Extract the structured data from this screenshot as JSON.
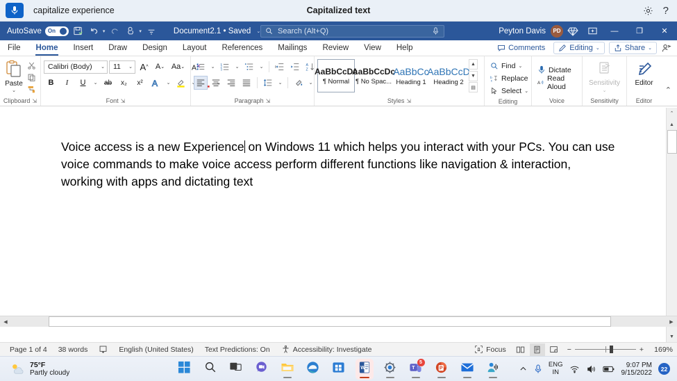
{
  "voice_access": {
    "mic_icon": "microphone-icon",
    "phrase": "capitalize experience",
    "title": "Capitalized text",
    "settings_icon": "gear-icon",
    "help_icon": "question-mark-icon"
  },
  "titlebar": {
    "autosave_label": "AutoSave",
    "autosave_state": "On",
    "save_icon": "save-icon",
    "undo_icon": "undo-icon",
    "redo_icon": "redo-icon",
    "touch_icon": "touch-mode-icon",
    "customize_icon": "customize-quick-access-icon",
    "document_name": "Document2.1 • Saved",
    "search_placeholder": "Search (Alt+Q)",
    "search_value": "",
    "search_icon": "search-icon",
    "search_mic_icon": "microphone-icon",
    "user_name": "Peyton Davis",
    "user_initials": "PD",
    "premium_icon": "diamond-icon",
    "ribbon_display_icon": "ribbon-display-options-icon",
    "minimize": "—",
    "restore": "❐",
    "close": "✕"
  },
  "tabs": [
    {
      "label": "File",
      "active": false
    },
    {
      "label": "Home",
      "active": true
    },
    {
      "label": "Insert",
      "active": false
    },
    {
      "label": "Draw",
      "active": false
    },
    {
      "label": "Design",
      "active": false
    },
    {
      "label": "Layout",
      "active": false
    },
    {
      "label": "References",
      "active": false
    },
    {
      "label": "Mailings",
      "active": false
    },
    {
      "label": "Review",
      "active": false
    },
    {
      "label": "View",
      "active": false
    },
    {
      "label": "Help",
      "active": false
    }
  ],
  "tabs_right": {
    "comments": "Comments",
    "editing": "Editing",
    "share": "Share",
    "catch_up_icon": "catch-up-person-icon"
  },
  "ribbon": {
    "clipboard": {
      "group_label": "Clipboard",
      "paste_label": "Paste",
      "cut_icon": "scissors-icon",
      "copy_icon": "copy-icon",
      "format_painter_icon": "format-painter-icon"
    },
    "font": {
      "group_label": "Font",
      "font_name": "Calibri (Body)",
      "font_size": "11",
      "grow_font": "A",
      "shrink_font": "A",
      "change_case": "Aa",
      "clear_formatting_icon": "clear-formatting-icon",
      "bold": "B",
      "italic": "I",
      "underline": "U",
      "strikethrough": "ab",
      "subscript": "x₂",
      "superscript": "x²",
      "text_effects_icon": "text-effects-icon",
      "highlight_icon": "highlight-icon",
      "font_color_icon": "font-color-icon"
    },
    "paragraph": {
      "group_label": "Paragraph",
      "bullets_icon": "bullets-icon",
      "numbering_icon": "numbering-icon",
      "multilevel_icon": "multilevel-list-icon",
      "decrease_indent_icon": "decrease-indent-icon",
      "increase_indent_icon": "increase-indent-icon",
      "sort_icon": "sort-icon",
      "show_marks_icon": "show-paragraph-marks-icon",
      "align_left_icon": "align-left-icon",
      "align_center_icon": "align-center-icon",
      "align_right_icon": "align-right-icon",
      "justify_icon": "justify-icon",
      "line_spacing_icon": "line-spacing-icon",
      "shading_icon": "shading-icon",
      "borders_icon": "borders-icon"
    },
    "styles": {
      "group_label": "Styles",
      "items": [
        {
          "preview": "AaBbCcDc",
          "name": "¶ Normal",
          "selected": true,
          "heading": false
        },
        {
          "preview": "AaBbCcDc",
          "name": "¶ No Spac...",
          "selected": false,
          "heading": false
        },
        {
          "preview": "AaBbCc",
          "name": "Heading 1",
          "selected": false,
          "heading": true
        },
        {
          "preview": "AaBbCcD",
          "name": "Heading 2",
          "selected": false,
          "heading": true
        }
      ]
    },
    "editing": {
      "group_label": "Editing",
      "find": "Find",
      "replace": "Replace",
      "select": "Select",
      "find_icon": "find-icon",
      "replace_icon": "replace-icon",
      "select_icon": "select-cursor-icon"
    },
    "voice": {
      "group_label": "Voice",
      "dictate": "Dictate",
      "read_aloud": "Read Aloud",
      "dictate_icon": "microphone-icon",
      "read_aloud_icon": "read-aloud-icon"
    },
    "sensitivity": {
      "group_label": "Sensitivity",
      "label": "Sensitivity",
      "icon": "sensitivity-label-icon"
    },
    "editor_group": {
      "group_label": "Editor",
      "label": "Editor",
      "icon": "editor-pen-icon",
      "collapse_icon": "collapse-ribbon-icon"
    }
  },
  "document": {
    "text_before_caret": "Voice access is a new Experience",
    "text_after_caret": " on Windows 11 which helps you interact with your PCs. You can use voice commands to make voice access perform different functions like navigation & interaction, working with apps and dictating text"
  },
  "statusbar": {
    "page": "Page 1 of 4",
    "words": "38 words",
    "proofing_icon": "proofing-errors-icon",
    "language": "English (United States)",
    "text_predictions": "Text Predictions: On",
    "accessibility_icon": "accessibility-icon",
    "accessibility": "Accessibility: Investigate",
    "focus": "Focus",
    "focus_icon": "focus-mode-icon",
    "read_mode_icon": "read-mode-icon",
    "print_layout_icon": "print-layout-icon",
    "web_layout_icon": "web-layout-icon",
    "zoom_out": "−",
    "zoom_in": "+",
    "zoom_level": "169%"
  },
  "taskbar": {
    "weather_temp": "75°F",
    "weather_desc": "Partly cloudy",
    "weather_icon": "partly-cloudy-icon",
    "start_icon": "windows-start-icon",
    "apps": [
      {
        "name": "search-icon",
        "active": false,
        "running": false,
        "badge": ""
      },
      {
        "name": "task-view-icon",
        "active": false,
        "running": false,
        "badge": ""
      },
      {
        "name": "chat-icon",
        "active": false,
        "running": false,
        "badge": ""
      },
      {
        "name": "file-explorer-icon",
        "active": false,
        "running": true,
        "badge": ""
      },
      {
        "name": "edge-icon",
        "active": false,
        "running": false,
        "badge": ""
      },
      {
        "name": "microsoft-store-icon",
        "active": false,
        "running": false,
        "badge": ""
      },
      {
        "name": "word-icon",
        "active": true,
        "running": true,
        "badge": ""
      },
      {
        "name": "settings-icon",
        "active": false,
        "running": true,
        "badge": ""
      },
      {
        "name": "teams-icon",
        "active": false,
        "running": true,
        "badge": "5"
      },
      {
        "name": "powerpoint-icon",
        "active": false,
        "running": true,
        "badge": ""
      },
      {
        "name": "mail-icon",
        "active": false,
        "running": true,
        "badge": ""
      },
      {
        "name": "voice-access-icon",
        "active": false,
        "running": true,
        "badge": ""
      }
    ],
    "tray_chevron_icon": "show-hidden-icons-icon",
    "tray_mic_icon": "microphone-icon",
    "language_line1": "ENG",
    "language_line2": "IN",
    "wifi_icon": "wifi-icon",
    "volume_icon": "speaker-icon",
    "battery_icon": "battery-icon",
    "time": "9:07 PM",
    "date": "9/15/2022",
    "notification_count": "22"
  },
  "colors": {
    "word_blue": "#2b579a",
    "accent_blue": "#0f63c8",
    "voice_bar_bg": "#eaf0f7"
  }
}
